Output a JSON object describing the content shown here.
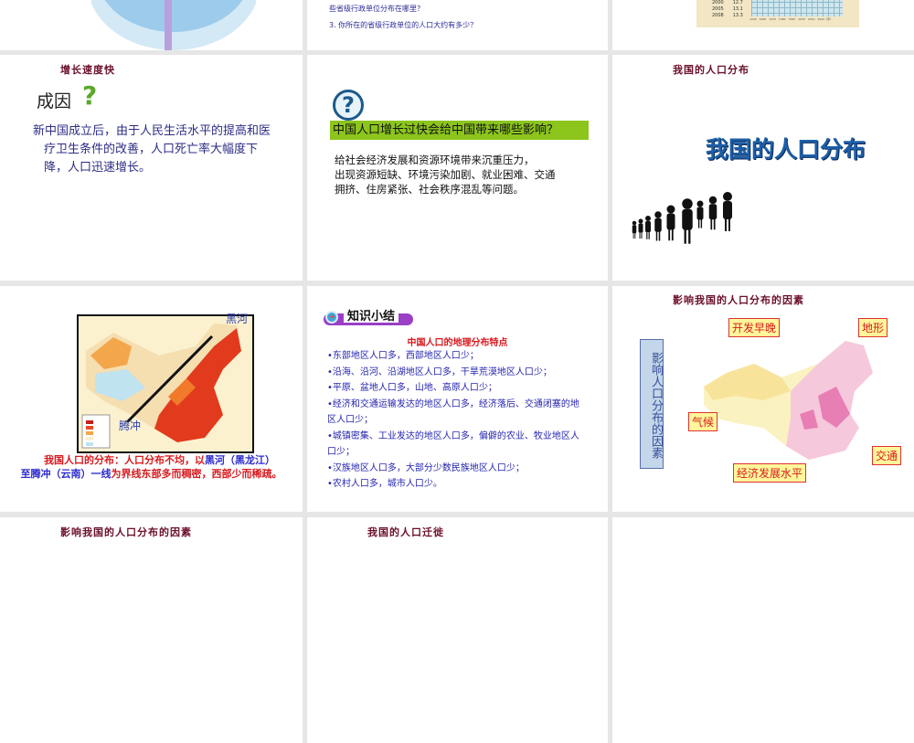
{
  "row0": {
    "s2_line1": "些省级行政单位分布在哪里？",
    "s2_line2": "3.  你所在的省级行政单位的人口大约有多少？",
    "s3_table": [
      [
        "2000",
        "12.7"
      ],
      [
        "2005",
        "13.1"
      ],
      [
        "2008",
        "13.3"
      ]
    ],
    "s3_axis": [
      "1949",
      "1960",
      "1970",
      "1980",
      "1990",
      "2000",
      "2010",
      "2020（年）"
    ]
  },
  "slide_growth": {
    "title": "增长速度快",
    "heading": "成因",
    "body": "新中国成立后，由于人民生活水平的提高和医疗卫生条件的改善，人口死亡率大幅度下降，人口迅速增长。"
  },
  "slide_impact": {
    "question": "中国人口增长过快会给中国带来哪些影响？",
    "answer": [
      "给社会经济发展和资源环境带来沉重压力，",
      "出现资源短缺、环境污染加剧、就业困难、交通",
      "拥挤、住房紧张、社会秩序混乱等问题。"
    ]
  },
  "slide_distribution": {
    "title": "我国的人口分布",
    "big_title": "我国的人口分布"
  },
  "slide_map": {
    "label_heihe": "黑河",
    "label_tengchong": "腾冲",
    "caption_red1": "我国人口的分布：人口分布不均，以",
    "caption_blue1": "黑河（黑龙江）",
    "caption_blue2": "至腾冲（云南）一线",
    "caption_red2": "为界线东部多而稠密，西部少而稀疏。"
  },
  "slide_summary": {
    "badge": "知识小结",
    "heading": "中国人口的地理分布特点",
    "items": [
      "•东部地区人口多，西部地区人口少；",
      "•沿海、沿河、沿湖地区人口多，干旱荒漠地区人口少；",
      "•平原、盆地人口多，山地、高原人口少；",
      "•经济和交通运输发达的地区人口多，经济落后、交通闭塞的地区人口少；",
      "•城镇密集、工业发达的地区人口多，偏僻的农业、牧业地区人口少；",
      "•汉族地区人口多，大部分少数民族地区人口少；",
      "•农村人口多，城市人口少。"
    ]
  },
  "slide_factors": {
    "title": "影响我国的人口分布的因素",
    "side": "影响人口分布的因素",
    "tags": {
      "kaifa": "开发早晚",
      "dixing": "地形",
      "qihou": "气候",
      "jiaotong": "交通",
      "jingji": "经济发展水平"
    }
  },
  "row3": {
    "t1": "影响我国的人口分布的因素",
    "t2": "我国的人口迁徙"
  }
}
